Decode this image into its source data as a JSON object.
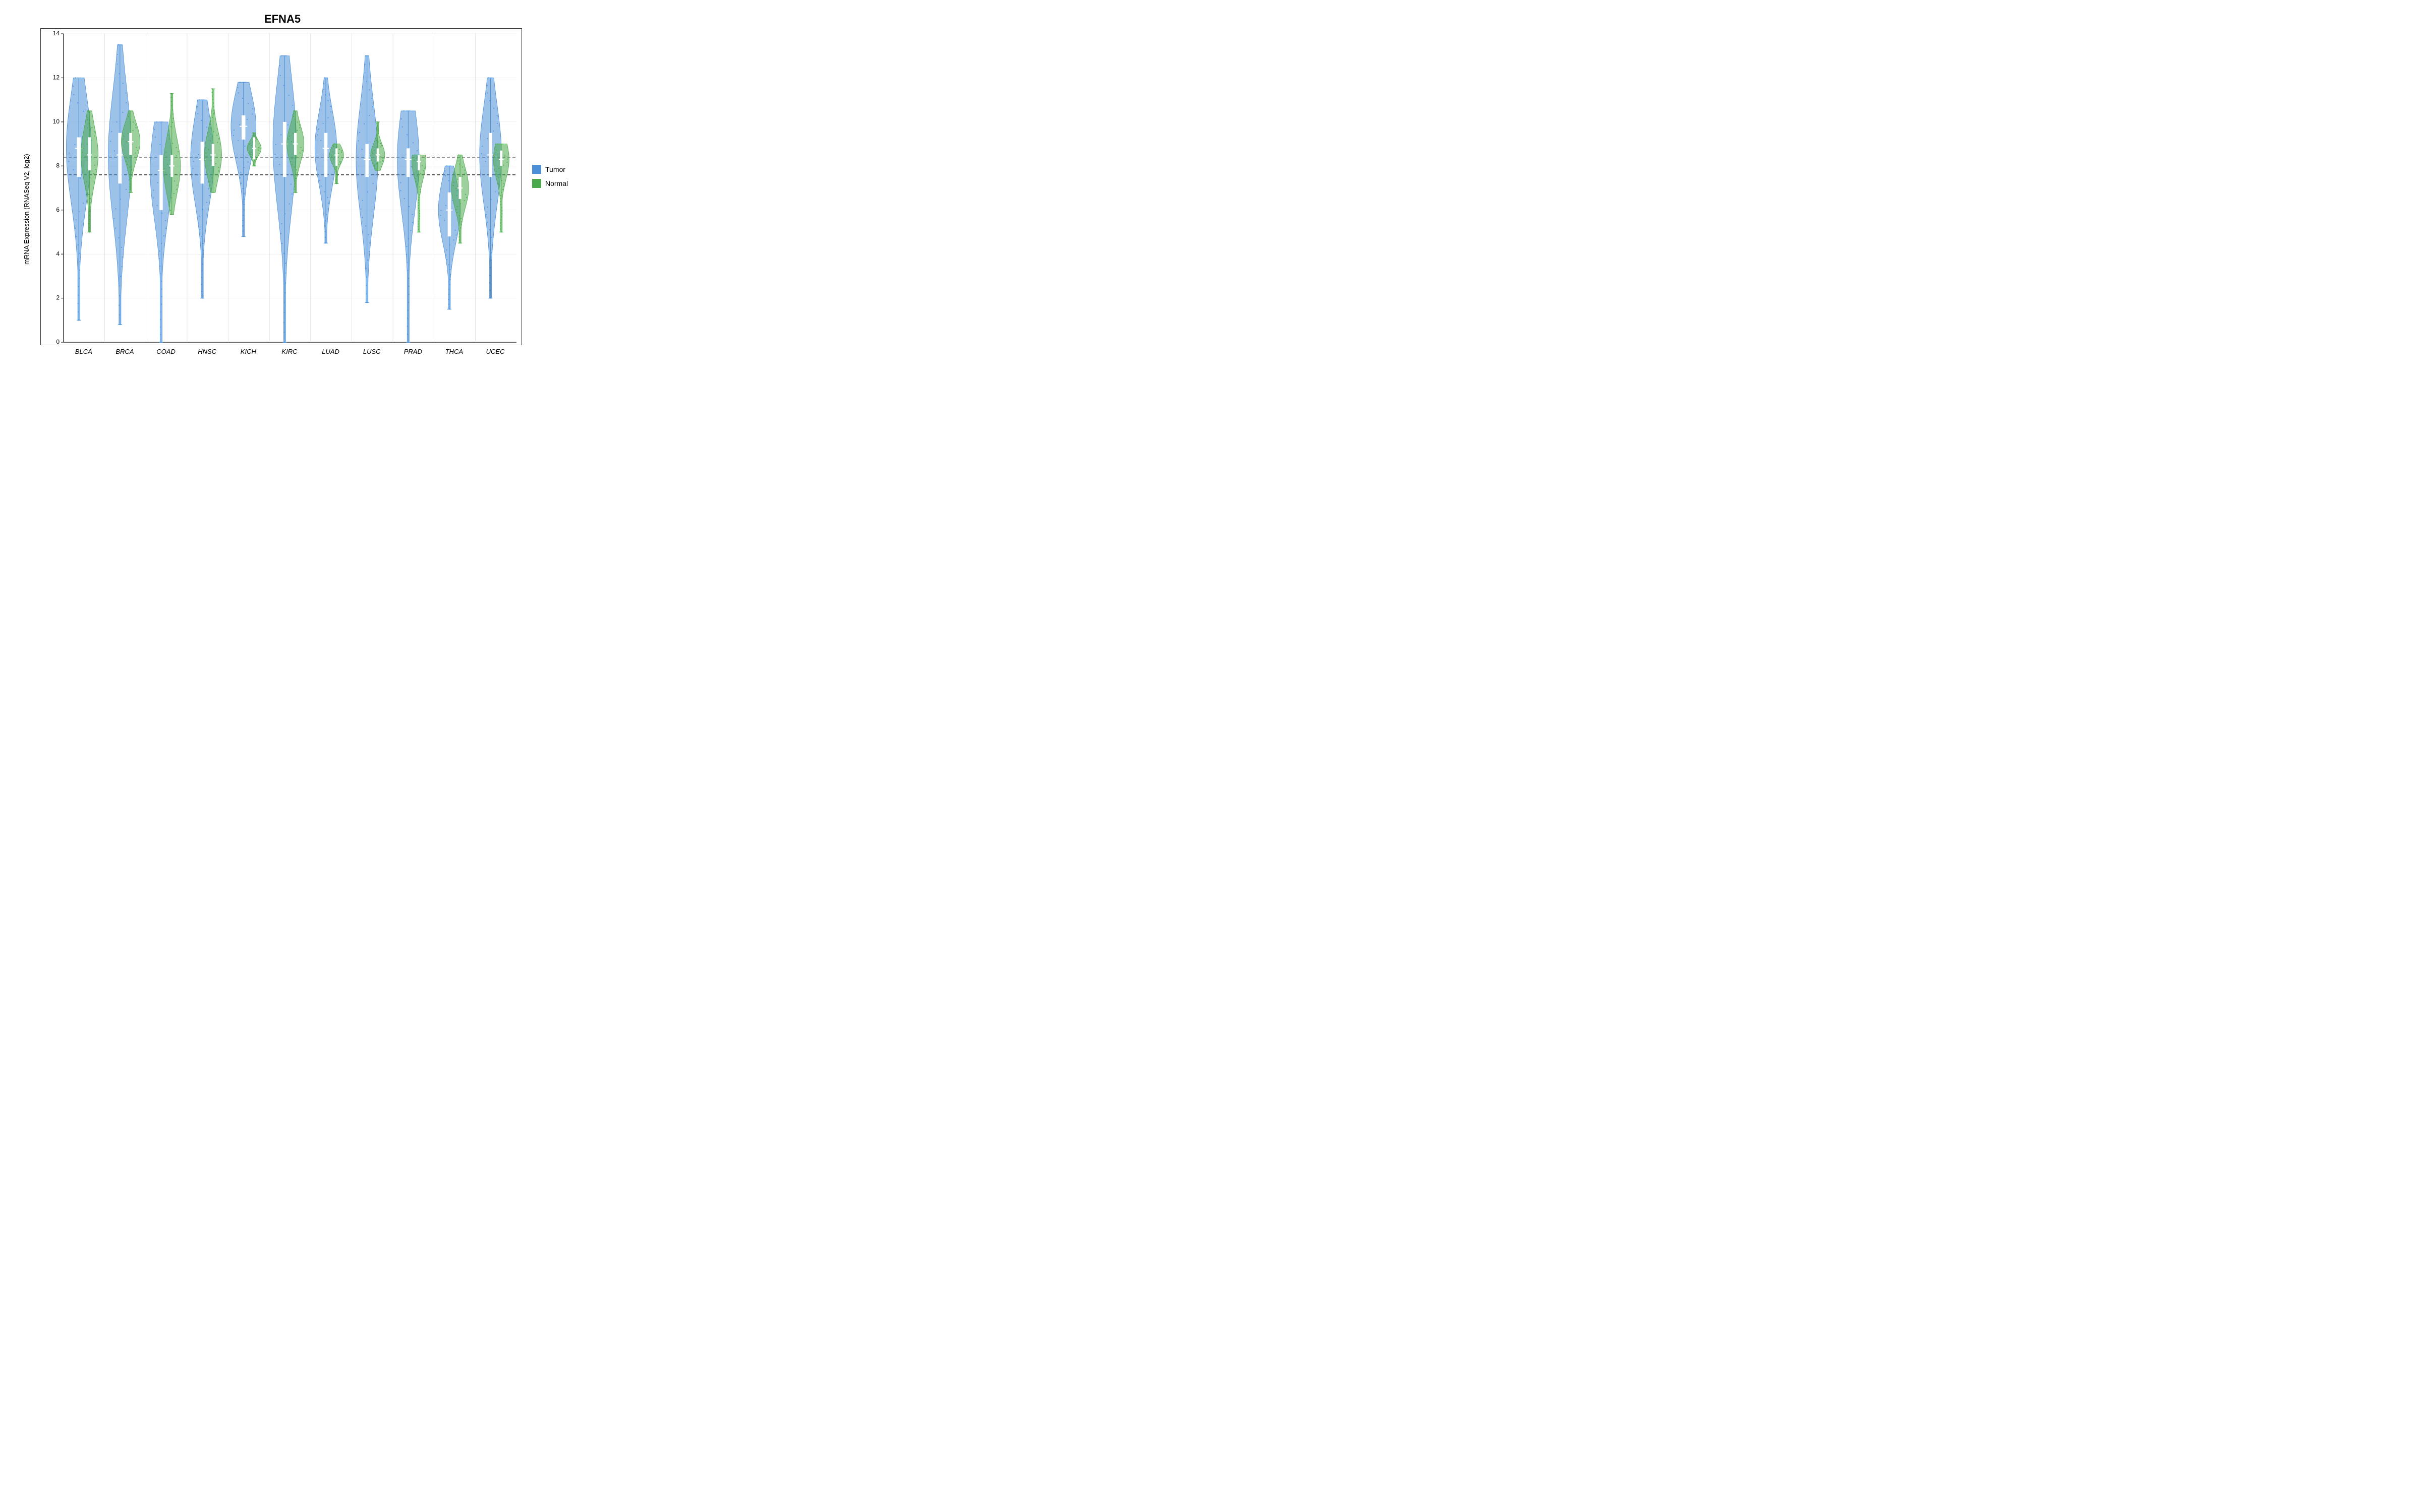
{
  "chart": {
    "title": "EFNA5",
    "y_axis_label": "mRNA Expression (RNASeq V2, log2)",
    "x_labels": [
      "BLCA",
      "BRCA",
      "COAD",
      "HNSC",
      "KICH",
      "KIRC",
      "LUAD",
      "LUSC",
      "PRAD",
      "THCA",
      "UCEC"
    ],
    "y_ticks": [
      0,
      2,
      4,
      6,
      8,
      10,
      12,
      14
    ],
    "legend": {
      "tumor_label": "Tumor",
      "normal_label": "Normal",
      "tumor_color": "#4a90d9",
      "normal_color": "#4aaa4a"
    },
    "dotted_line1_y": 7.6,
    "dotted_line2_y": 8.4
  }
}
